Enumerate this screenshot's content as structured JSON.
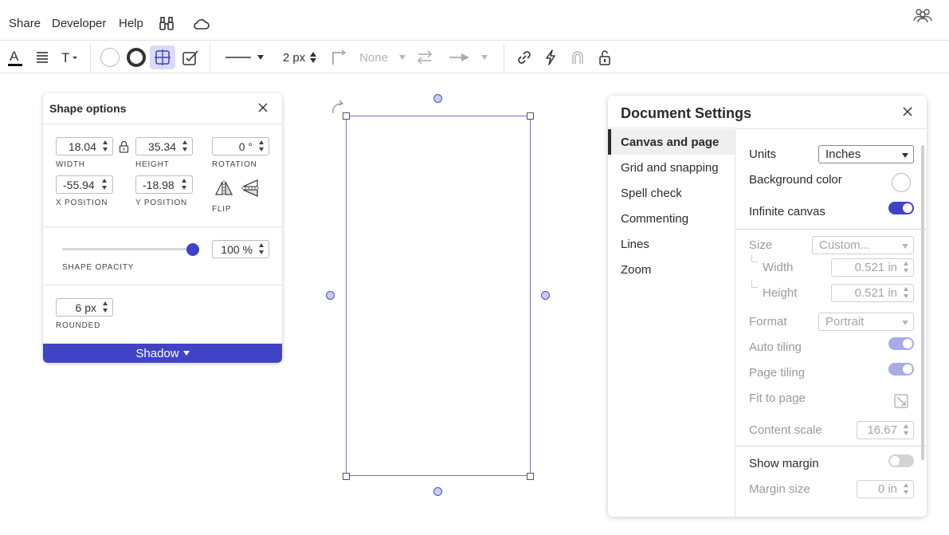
{
  "menubar": {
    "items": [
      "Share",
      "Developer",
      "Help"
    ],
    "icons": [
      "binoculars-icon",
      "cloud-icon",
      "users-icon"
    ]
  },
  "toolbar": {
    "line_width": "2 px",
    "end_arrow": "None"
  },
  "shape_options": {
    "title": "Shape options",
    "width": "18.04",
    "height": "35.34",
    "rotation": "0 °",
    "x_position": "-55.94",
    "y_position": "-18.98",
    "opacity": "100 %",
    "opacity_level": 1.0,
    "rounded": "6 px",
    "labels": {
      "width": "WIDTH",
      "height": "HEIGHT",
      "rotation": "ROTATION",
      "x_position": "X POSITION",
      "y_position": "Y POSITION",
      "flip": "FLIP",
      "opacity": "SHAPE OPACITY",
      "rounded": "ROUNDED"
    },
    "shadow_label": "Shadow"
  },
  "document_settings": {
    "title": "Document Settings",
    "nav": [
      "Canvas and page",
      "Grid and snapping",
      "Spell check",
      "Commenting",
      "Lines",
      "Zoom"
    ],
    "active_nav": "Canvas and page",
    "units_label": "Units",
    "units_value": "Inches",
    "background_color_label": "Background color",
    "background_color": "#ffffff",
    "infinite_canvas_label": "Infinite canvas",
    "infinite_canvas_on": true,
    "size_label": "Size",
    "size_value": "Custom...",
    "width_label": "Width",
    "width_value": "0.521 in",
    "height_label": "Height",
    "height_value": "0.521 in",
    "format_label": "Format",
    "format_value": "Portrait",
    "auto_tiling_label": "Auto tiling",
    "page_tiling_label": "Page tiling",
    "fit_to_page_label": "Fit to page",
    "content_scale_label": "Content scale",
    "content_scale_value": "16.67",
    "show_margin_label": "Show margin",
    "show_margin_on": false,
    "margin_size_label": "Margin size",
    "margin_size_value": "0 in"
  },
  "colors": {
    "accent": "#3f43c4",
    "selection": "#6d71d4",
    "toggle_disabled_on": "#a9abe6"
  }
}
